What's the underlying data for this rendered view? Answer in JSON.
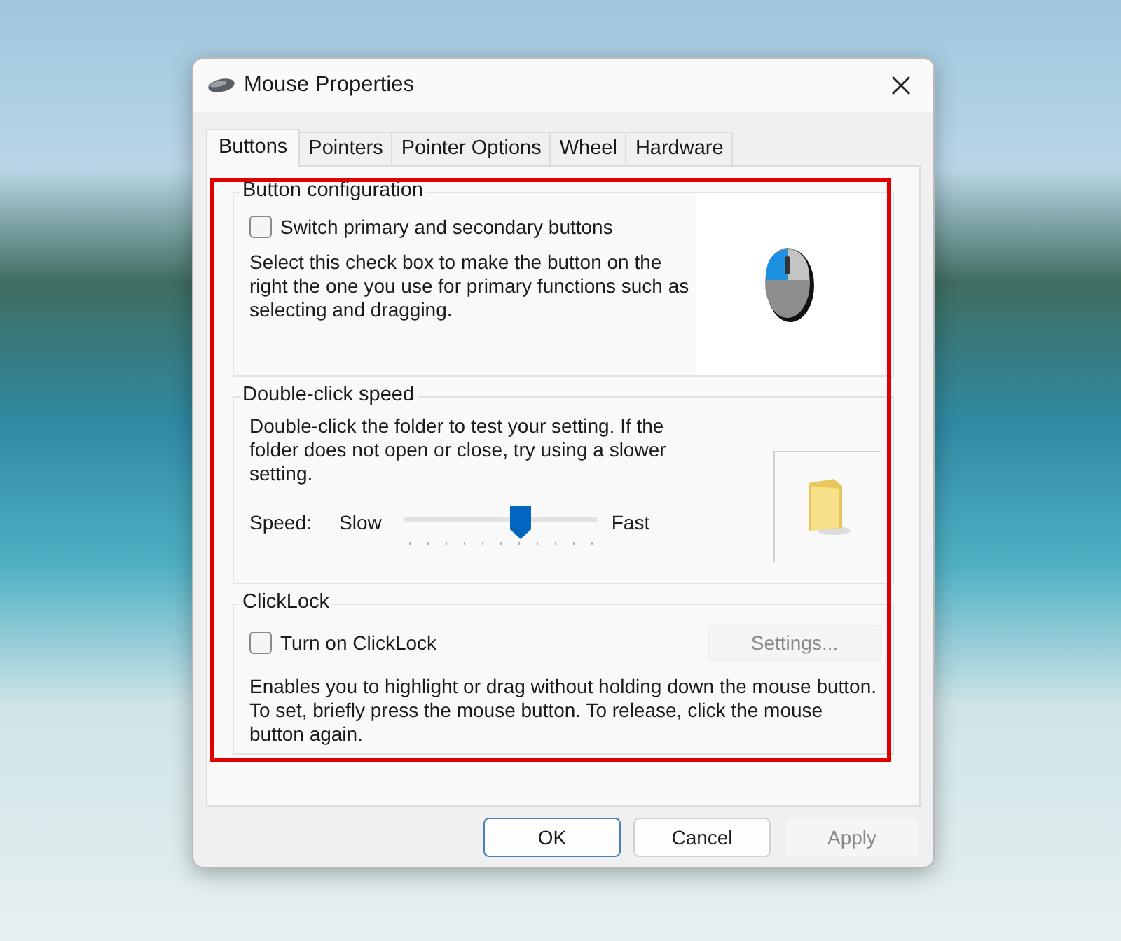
{
  "window": {
    "title": "Mouse Properties"
  },
  "tabs": [
    {
      "label": "Buttons",
      "selected": true
    },
    {
      "label": "Pointers",
      "selected": false
    },
    {
      "label": "Pointer Options",
      "selected": false
    },
    {
      "label": "Wheel",
      "selected": false
    },
    {
      "label": "Hardware",
      "selected": false
    }
  ],
  "button_configuration": {
    "title": "Button configuration",
    "checkbox": {
      "label": "Switch primary and secondary buttons",
      "checked": false
    },
    "description": "Select this check box to make the button on the right the one you use for primary functions such as selecting and dragging."
  },
  "double_click_speed": {
    "title": "Double-click speed",
    "description": "Double-click the folder to test your setting. If the folder does not open or close, try using a slower setting.",
    "speed_label": "Speed:",
    "slow_label": "Slow",
    "fast_label": "Fast",
    "level": 0.6
  },
  "clicklock": {
    "title": "ClickLock",
    "checkbox": {
      "label": "Turn on ClickLock",
      "checked": false
    },
    "settings_button": {
      "label": "Settings...",
      "disabled": true
    },
    "description": "Enables you to highlight or drag without holding down the mouse button. To set, briefly press the mouse button. To release, click the mouse button again."
  },
  "buttons": [
    {
      "label": "OK",
      "default": true,
      "disabled": false
    },
    {
      "label": "Cancel",
      "default": false,
      "disabled": false
    },
    {
      "label": "Apply",
      "default": false,
      "disabled": true
    }
  ]
}
